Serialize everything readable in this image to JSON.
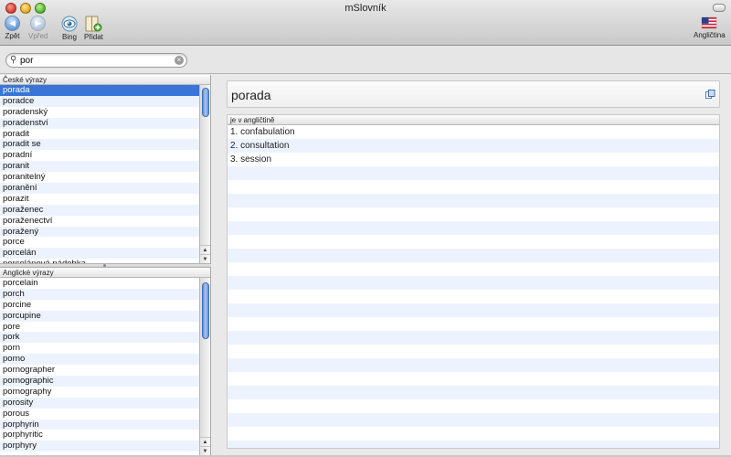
{
  "window": {
    "title": "mSlovník"
  },
  "toolbar": {
    "back_label": "Zpět",
    "forward_label": "Vpřed",
    "bing_label": "Bing",
    "add_label": "Přidat",
    "language_label": "Angličtina"
  },
  "search": {
    "value": "por",
    "placeholder": ""
  },
  "czech_list": {
    "header": "České výrazy",
    "selected": "porada",
    "items": [
      "porada",
      "poradce",
      "poradenský",
      "poradenství",
      "poradit",
      "poradit se",
      "poradní",
      "poranit",
      "poranitelný",
      "poranění",
      "porazit",
      "poraženec",
      "poraženectví",
      "poražený",
      "porce",
      "porcelán",
      "porcelánová nádobka"
    ]
  },
  "english_list": {
    "header": "Anglické výrazy",
    "items": [
      "porcelain",
      "porch",
      "porcine",
      "porcupine",
      "pore",
      "pork",
      "porn",
      "porno",
      "pornographer",
      "pornographic",
      "pornography",
      "porosity",
      "porous",
      "porphyrin",
      "porphyritic",
      "porphyry"
    ]
  },
  "detail": {
    "word": "porada",
    "section_header": "je v angličtině",
    "translations": [
      "1. confabulation",
      "2. consultation",
      "3. session"
    ]
  },
  "colors": {
    "selection": "#3875d7",
    "stripe": "#edf3fe",
    "scroll_thumb": "#6a9ae0"
  }
}
